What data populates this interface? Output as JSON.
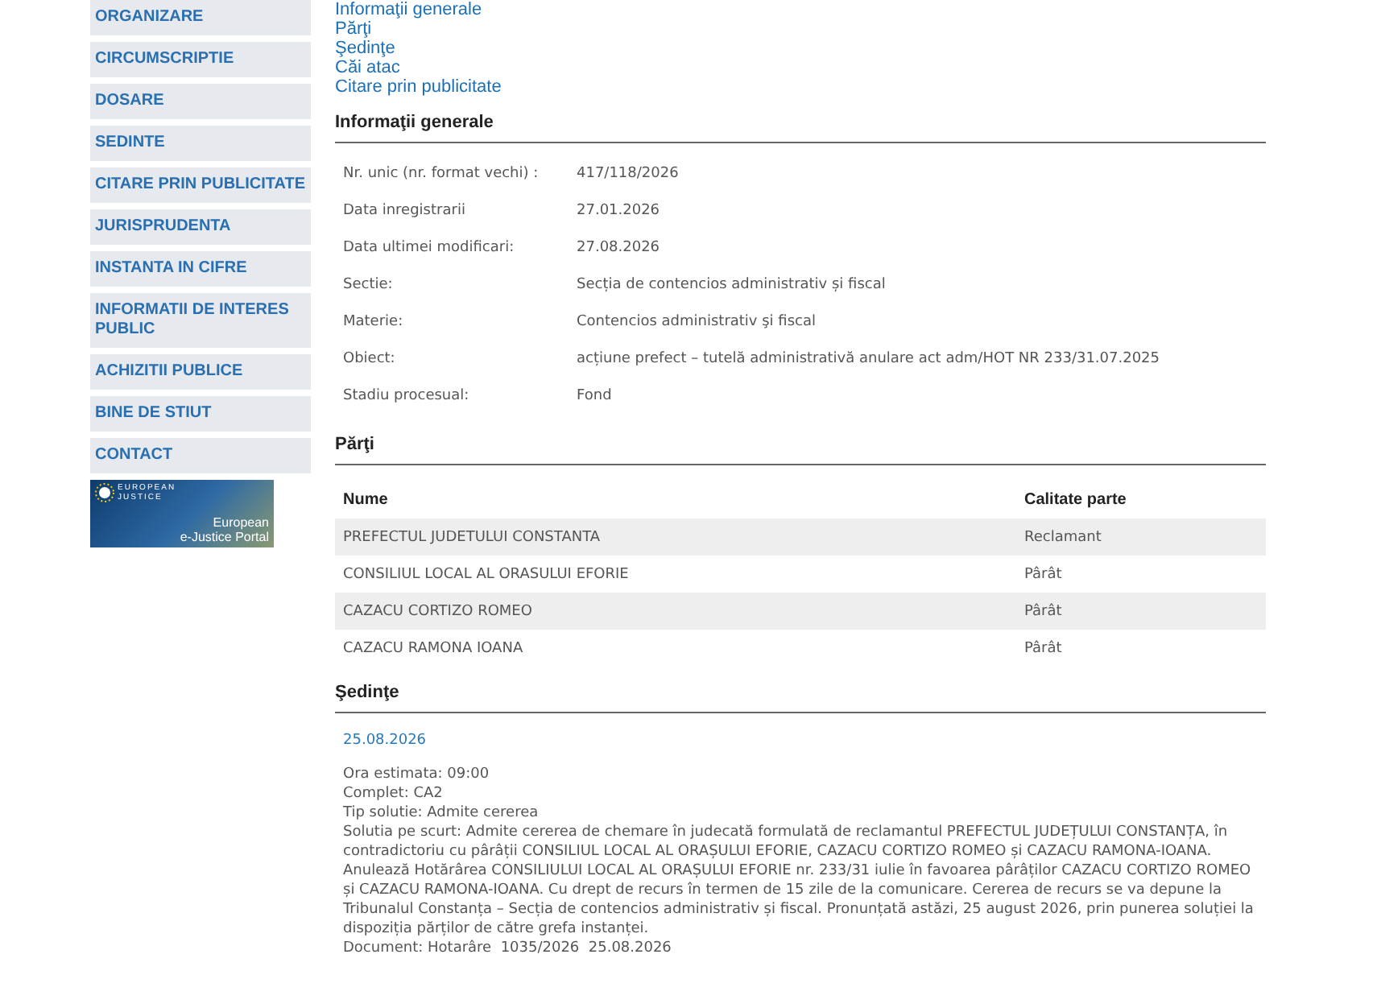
{
  "sidebar": {
    "items": [
      "ORGANIZARE",
      "CIRCUMSCRIPTIE",
      "DOSARE",
      "SEDINTE",
      "CITARE PRIN PUBLICITATE",
      "JURISPRUDENTA",
      "INSTANTA IN CIFRE",
      "INFORMATII DE INTERES PUBLIC",
      "ACHIZITII PUBLICE",
      "BINE DE STIUT",
      "CONTACT"
    ],
    "banner": {
      "brand_top": "EUROPEAN",
      "brand_bottom": "JUSTICE",
      "title": "European",
      "subtitle": "e-Justice Portal"
    }
  },
  "anchors": [
    "Informaţii generale",
    "Părţi",
    "Şedinţe",
    "Căi atac",
    "Citare prin publicitate"
  ],
  "general": {
    "heading": "Informaţii generale",
    "fields": [
      {
        "label": "Nr. unic (nr. format vechi) :",
        "value": "417/118/2026"
      },
      {
        "label": "Data inregistrarii",
        "value": "27.01.2026"
      },
      {
        "label": "Data ultimei modificari:",
        "value": "27.08.2026"
      },
      {
        "label": "Sectie:",
        "value": "Secția de contencios administrativ și fiscal"
      },
      {
        "label": "Materie:",
        "value": "Contencios administrativ şi fiscal"
      },
      {
        "label": "Obiect:",
        "value": "acțiune prefect – tutelă administrativă anulare act adm/HOT NR 233/31.07.2025"
      },
      {
        "label": "Stadiu procesual:",
        "value": "Fond"
      }
    ]
  },
  "parties": {
    "heading": "Părţi",
    "columns": [
      "Nume",
      "Calitate parte"
    ],
    "rows": [
      [
        "PREFECTUL JUDETULUI CONSTANTA",
        "Reclamant"
      ],
      [
        "CONSILIUL LOCAL AL ORASULUI EFORIE",
        "Pârât"
      ],
      [
        "CAZACU CORTIZO ROMEO",
        "Pârât"
      ],
      [
        "CAZACU RAMONA IOANA",
        "Pârât"
      ]
    ]
  },
  "hearings": {
    "heading": "Şedinţe",
    "items": [
      {
        "date": "25.08.2026",
        "lines": [
          "Ora estimata: 09:00",
          "Complet: CA2",
          "Tip solutie: Admite cererea",
          "Solutia pe scurt: Admite cererea de chemare în judecată formulată de reclamantul PREFECTUL JUDEȚULUI CONSTANȚA, în contradictoriu cu pârâții CONSILIUL LOCAL AL ORAȘULUI EFORIE, CAZACU CORTIZO ROMEO și CAZACU RAMONA-IOANA. Anulează Hotărârea CONSILIULUI LOCAL AL ORAȘULUI EFORIE nr. 233/31 iulie în favoarea pârâților CAZACU CORTIZO ROMEO și CAZACU RAMONA-IOANA. Cu drept de recurs în termen de 15 zile de la comunicare. Cererea de recurs se va depune la Tribunalul Constanța – Secția de contencios administrativ și fiscal. Pronunțată astăzi, 25 august 2026, prin punerea soluției la dispoziția părților de către grefa instanței.",
          "Document: Hotarâre  1035/2026  25.08.2026"
        ]
      }
    ]
  }
}
